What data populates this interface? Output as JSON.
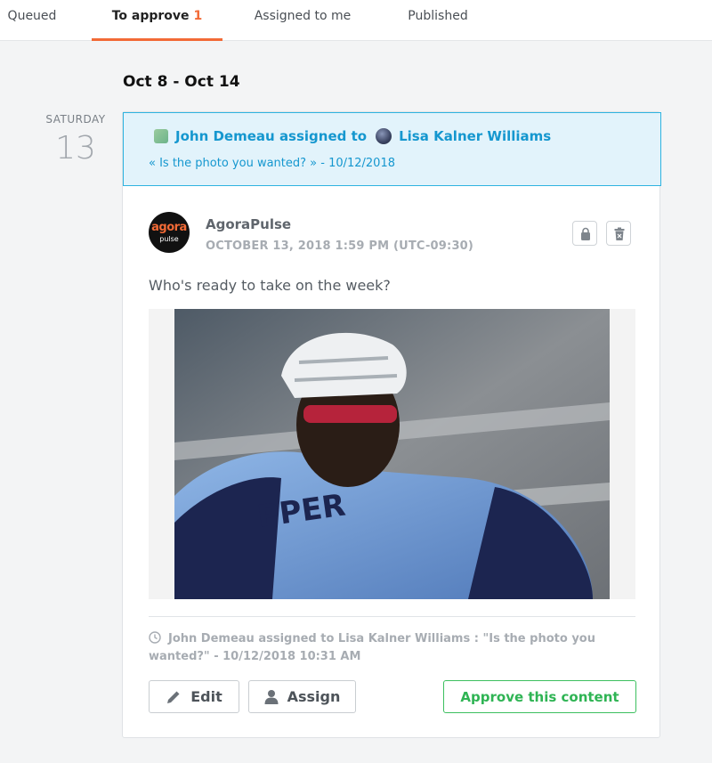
{
  "tabs": [
    {
      "label": "Queued"
    },
    {
      "label": "To approve",
      "count": "1"
    },
    {
      "label": "Assigned to me"
    },
    {
      "label": "Published"
    }
  ],
  "week_label": "Oct 8 - Oct 14",
  "day": {
    "name": "SATURDAY",
    "number": "13"
  },
  "banner": {
    "assigner": "John Demeau",
    "assigned_to_text": "assigned to",
    "assignee": "Lisa Kalner Williams",
    "note": "« Is the photo you wanted? » - 10/12/2018"
  },
  "post": {
    "account_name": "AgoraPulse",
    "avatar_brand": "agora",
    "avatar_sub": "pulse",
    "date": "OCTOBER 13, 2018 1:59 PM (UTC-09:30)",
    "text": "Who's ready to take on the week?",
    "log": "John Demeau assigned to Lisa Kalner Williams : \"Is the photo you wanted?\" - 10/12/2018 10:31 AM"
  },
  "actions": {
    "edit": "Edit",
    "assign": "Assign",
    "approve": "Approve this content"
  },
  "colors": {
    "accent": "#f26a36",
    "info": "#1597cf",
    "approve": "#2fb454"
  },
  "icons": {
    "lock": "lock-icon",
    "trash": "trash-icon",
    "clock": "clock-icon",
    "pencil": "pencil-icon",
    "user": "user-icon"
  }
}
